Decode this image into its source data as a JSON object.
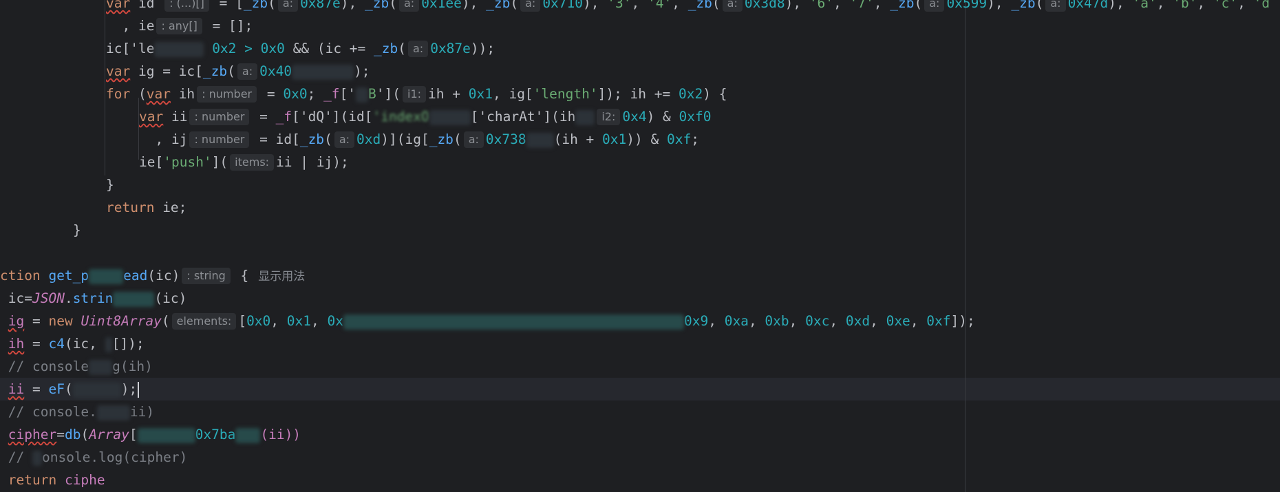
{
  "hints": {
    "id": ": (...)[]",
    "ie": ": any[]",
    "a": "a:",
    "number": ": number",
    "i1": "i1:",
    "i2": "i2:",
    "items": "items:",
    "string": ": string",
    "elements": "elements:"
  },
  "code": {
    "l1": {
      "var": "var",
      "id": " id ",
      "rest_a": " = [",
      "zb": "_zb",
      "paren": "(",
      "n1": "0x87e",
      "sep": "), ",
      "n2": "0x1ee",
      "n3": "0x710",
      "s3": "'3'",
      "s4": "'4'",
      "n4": "0x3d8",
      "s6": "'6'",
      "s7": "'7'",
      "n5": "0x599",
      "n6": "0x47d",
      "sa": "'a'",
      "sb": "'b'",
      "sc": "'c'",
      "sd": "'d"
    },
    "l2": {
      "pre": "  , ie",
      "post": " = [];"
    },
    "l3": {
      "pre": "ic['le",
      "gt": " 0x2 > ",
      "zero": "0x0",
      "mid": " && (ic += ",
      "zb": "_zb",
      "open": "(",
      "n": "0x87e",
      "close": "));"
    },
    "l4": {
      "var": "var",
      "mid": " ig = ic[",
      "zb": "_zb",
      "open": "(",
      "n": "0x40",
      "close": ");"
    },
    "l5": {
      "for": "for",
      "open": " (",
      "var": "var",
      "ih": " ih",
      "eq": " = ",
      "zero": "0x0",
      "semi": "; ",
      "f": "_f",
      "bracket": "['",
      "b": "B",
      "call": "'](",
      "mid": "ih + ",
      "one": "0x1",
      "len": ", ig[",
      "lenstr": "'length'",
      "rest": "]); ih += ",
      "two": "0x2",
      "end": ") {"
    },
    "l6": {
      "var": "var",
      "ii": " ii",
      "eq": " = ",
      "f": "_f",
      "dq": "['dQ'](id[",
      "indexo": "'indexO",
      "charat": "['charAt'](ih",
      "x4": "0x4",
      "and": ") & ",
      "f0": "0xf0"
    },
    "l7": {
      "ij": "  , ij",
      "eq": " = id[",
      "zb": "_zb",
      "open": "(",
      "d": "0xd",
      "mid": ")](ig[",
      "zb2": "_zb",
      "open2": "(",
      "n": "0x738",
      "ih": "(ih + ",
      "one": "0x1",
      "close": ")) ",
      "amp": "& ",
      "f": "0xf",
      "semi": ";"
    },
    "l8": {
      "pre": "ie[",
      "push": "'push'",
      "open": "](",
      "post": "ii | ij);"
    },
    "l9": {
      "brace": "}"
    },
    "l10": {
      "ret": "return",
      "post": " ie;"
    },
    "l11": {
      "brace": "}"
    },
    "l12": {
      "kw": "ction",
      "sp": " ",
      "name": "get_p",
      "name2": "ead",
      "args": "(ic)",
      "brace": " {",
      "usage": "显示用法"
    },
    "l13": {
      "pre": " ic=",
      "json": "JSON",
      "dot": ".",
      "str": "strin",
      "post": "(ic)"
    },
    "l14": {
      "ig": "ig",
      "eq": " = ",
      "new": "new",
      "sp": " ",
      "cls": "Uint8Array",
      "open": "(",
      "br": "[",
      "n0": "0x0",
      "c": ", ",
      "n1": "0x1",
      "n2": "0x",
      "n9": "0x9",
      "na": "0xa",
      "nb": "0xb",
      "nc": "0xc",
      "nd": "0xd",
      "ne": "0xe",
      "nf": "0xf",
      "close": "]);"
    },
    "l15": {
      "ih": "ih",
      "eq": " = ",
      "fn": "c4",
      "post": "(ic, ",
      "end": "[]);"
    },
    "l16": {
      "cmt1": "// console",
      "cmt2": "g(ih)"
    },
    "l17": {
      "ii": "ii",
      "eq": " = ",
      "fn": "eF",
      "open": "(",
      "close": ");"
    },
    "l18": {
      "cmt1": "// console.",
      "cmt2": "ii)"
    },
    "l19": {
      "var": "cipher",
      "eq": "=",
      "fn": "db",
      "open": "(",
      "arr": "Array",
      "b": "[",
      "n": "0x7ba",
      "close": "(ii))"
    },
    "l20": {
      "cmt": "// ",
      "cmt2": "onsole.log(cipher)"
    },
    "l21": {
      "ret": "return",
      "sp": " ",
      "var": "ciphe"
    }
  }
}
